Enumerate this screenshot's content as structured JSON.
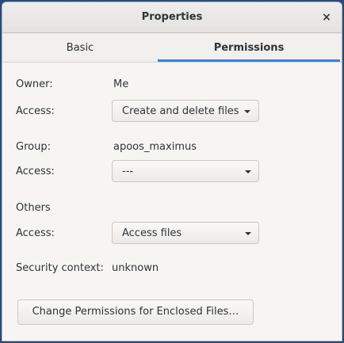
{
  "window": {
    "title": "Properties",
    "close_label": "×"
  },
  "tabs": [
    {
      "label": "Basic",
      "active": false
    },
    {
      "label": "Permissions",
      "active": true
    }
  ],
  "owner": {
    "label": "Owner:",
    "value": "Me",
    "access_label": "Access:",
    "access_value": "Create and delete files"
  },
  "group": {
    "label": "Group:",
    "value": "apoos_maximus",
    "access_label": "Access:",
    "access_value": "---"
  },
  "others": {
    "label": "Others",
    "access_label": "Access:",
    "access_value": "Access files"
  },
  "security": {
    "label": "Security context:",
    "value": "unknown"
  },
  "enclosed_button": {
    "label": "Change Permissions for Enclosed Files…"
  },
  "colors": {
    "accent": "#3584e4",
    "window_bg": "#f6f5f4",
    "text": "#2e3436"
  }
}
